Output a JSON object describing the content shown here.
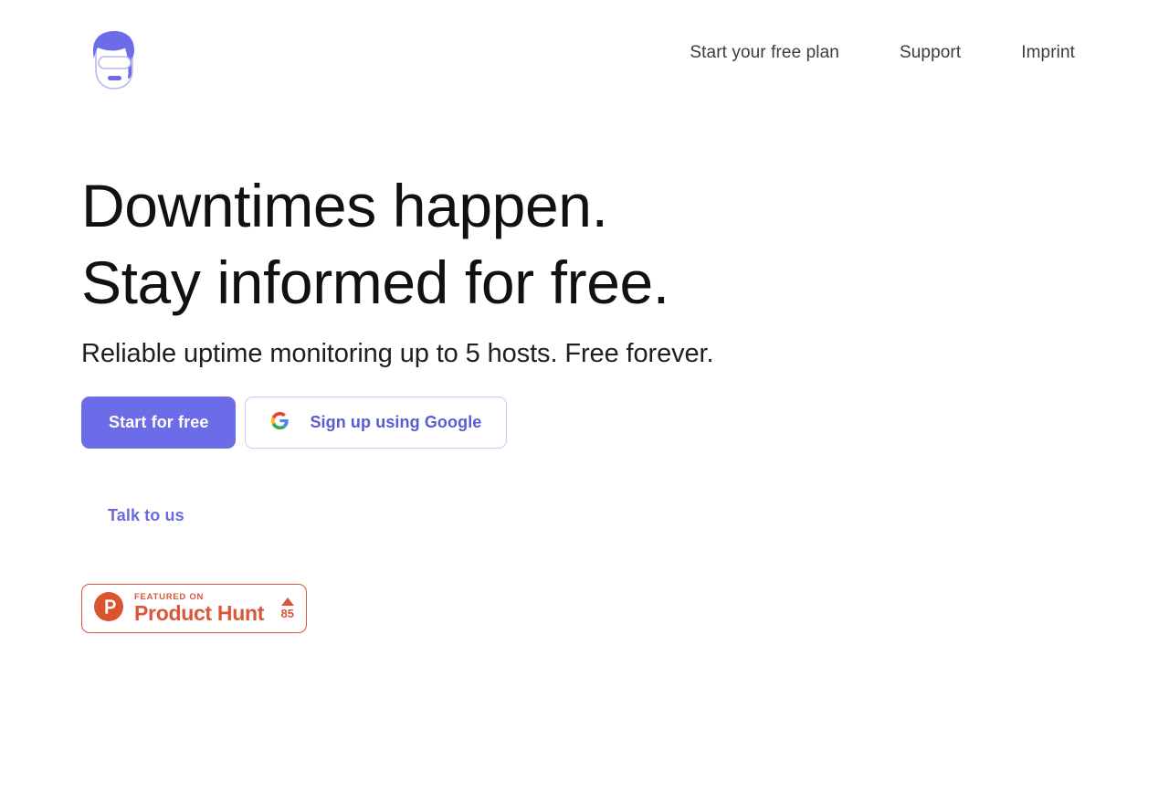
{
  "brand": {
    "logo_name": "uptime-monitor-logo",
    "primary_color": "#6c6ce8",
    "accent_color": "#d9563a"
  },
  "nav": {
    "links": [
      {
        "label": "Start your free plan"
      },
      {
        "label": "Support"
      },
      {
        "label": "Imprint"
      }
    ]
  },
  "hero": {
    "headline_line1": "Downtimes happen.",
    "headline_line2": "Stay informed for free.",
    "subheadline": "Reliable uptime monitoring up to 5 hosts. Free forever.",
    "primary_cta": "Start for free",
    "google_cta": "Sign up using Google",
    "talk_link": "Talk to us"
  },
  "product_hunt": {
    "featured_label": "FEATURED ON",
    "name": "Product Hunt",
    "upvotes": "85"
  }
}
